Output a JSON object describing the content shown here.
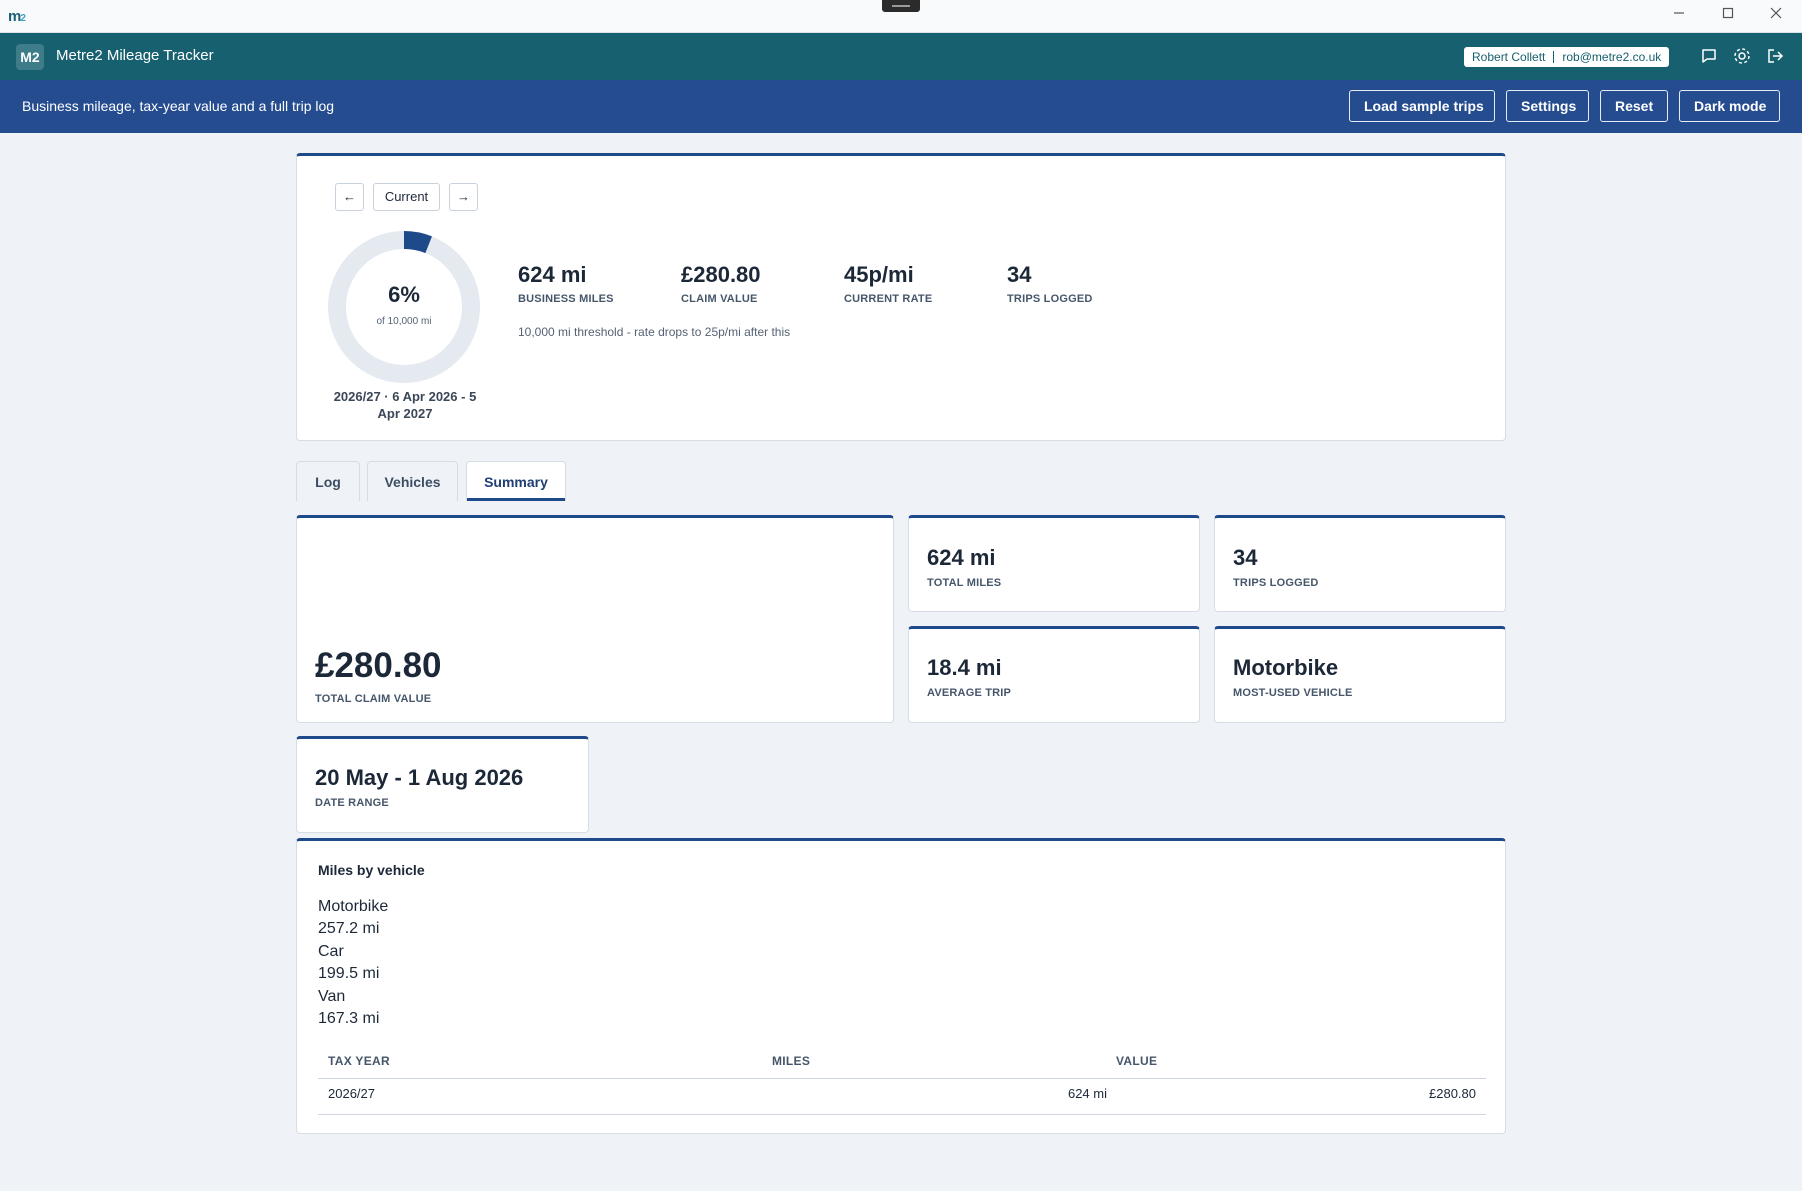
{
  "window": {
    "logo": "m",
    "logo_sub": "2"
  },
  "app": {
    "badge": "M2",
    "title": "Metre2 Mileage Tracker",
    "user_name": "Robert Collett",
    "user_email": "rob@metre2.co.uk"
  },
  "subheader": {
    "tagline": "Business mileage, tax-year value and a full trip log",
    "buttons": {
      "load_sample": "Load sample trips",
      "settings": "Settings",
      "reset": "Reset",
      "dark_mode": "Dark mode"
    }
  },
  "overview": {
    "nav_prev": "←",
    "nav_current": "Current",
    "nav_next": "→",
    "progress_percent": 6,
    "progress_label": "6%",
    "progress_sub": "of 10,000 mi",
    "period": "2026/27 · 6 Apr 2026 - 5 Apr 2027",
    "stats": [
      {
        "value": "624 mi",
        "label": "BUSINESS MILES"
      },
      {
        "value": "£280.80",
        "label": "CLAIM VALUE"
      },
      {
        "value": "45p/mi",
        "label": "CURRENT RATE"
      },
      {
        "value": "34",
        "label": "TRIPS LOGGED"
      }
    ],
    "threshold_note": "10,000 mi threshold - rate drops to 25p/mi after this"
  },
  "tabs": [
    {
      "label": "Log",
      "active": false
    },
    {
      "label": "Vehicles",
      "active": false
    },
    {
      "label": "Summary",
      "active": true
    }
  ],
  "summary": {
    "total_claim": {
      "value": "£280.80",
      "label": "TOTAL CLAIM VALUE"
    },
    "total_miles": {
      "value": "624 mi",
      "label": "TOTAL MILES"
    },
    "trips_logged": {
      "value": "34",
      "label": "TRIPS LOGGED"
    },
    "average_trip": {
      "value": "18.4 mi",
      "label": "AVERAGE TRIP"
    },
    "most_used": {
      "value": "Motorbike",
      "label": "MOST-USED VEHICLE"
    },
    "date_range": {
      "value": "20 May - 1 Aug 2026",
      "label": "DATE RANGE"
    }
  },
  "miles_by_vehicle": {
    "title": "Miles by vehicle",
    "items": [
      {
        "name": "Motorbike",
        "miles": "257.2 mi"
      },
      {
        "name": "Car",
        "miles": "199.5 mi"
      },
      {
        "name": "Van",
        "miles": "167.3 mi"
      }
    ],
    "table": {
      "headers": [
        "TAX YEAR",
        "MILES",
        "VALUE"
      ],
      "rows": [
        [
          "2026/27",
          "624 mi",
          "£280.80"
        ]
      ]
    }
  },
  "colors": {
    "app_header": "#17606f",
    "sub_header": "#254c8f",
    "accent": "#1f4a8a",
    "background": "#eff3f8"
  },
  "icons": {
    "header": [
      "chat-icon",
      "gear-icon",
      "logout-icon"
    ],
    "window": [
      "minimize-icon",
      "maximize-icon",
      "close-icon"
    ]
  }
}
